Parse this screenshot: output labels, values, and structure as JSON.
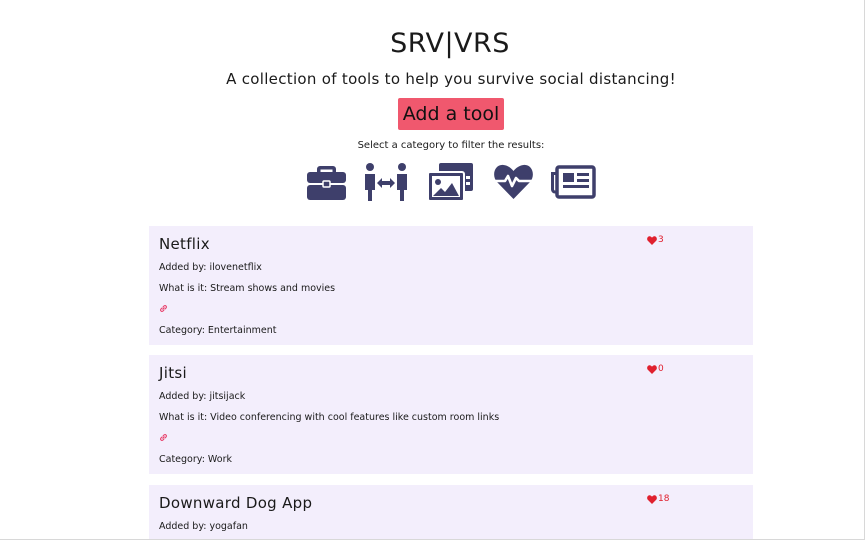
{
  "header": {
    "title": "SRV|VRS",
    "subtitle": "A collection of tools to help you survive social distancing!",
    "add_button": "Add a tool",
    "filter_hint": "Select a category to filter the results:"
  },
  "categories": [
    {
      "icon": "briefcase-icon",
      "meaning": "Work"
    },
    {
      "icon": "people-distance-icon",
      "meaning": "Social"
    },
    {
      "icon": "photo-gallery-icon",
      "meaning": "Entertainment"
    },
    {
      "icon": "heartbeat-icon",
      "meaning": "Health"
    },
    {
      "icon": "newspaper-icon",
      "meaning": "News"
    }
  ],
  "tools": [
    {
      "name": "Netflix",
      "added_by": "Added by: ilovenetflix",
      "description": "What is it: Stream shows and movies",
      "category": "Category: Entertainment",
      "likes": "3"
    },
    {
      "name": "Jitsi",
      "added_by": "Added by: jitsijack",
      "description": "What is it: Video conferencing with cool features like custom room links",
      "category": "Category: Work",
      "likes": "0"
    },
    {
      "name": "Downward Dog App",
      "added_by": "Added by: yogafan",
      "description": "",
      "category": "",
      "likes": "18"
    }
  ],
  "colors": {
    "accent": "#f0586e",
    "icon": "#3e3f6b",
    "card_bg": "#f3eefc",
    "like": "#e0202e",
    "link": "#e8416c"
  }
}
